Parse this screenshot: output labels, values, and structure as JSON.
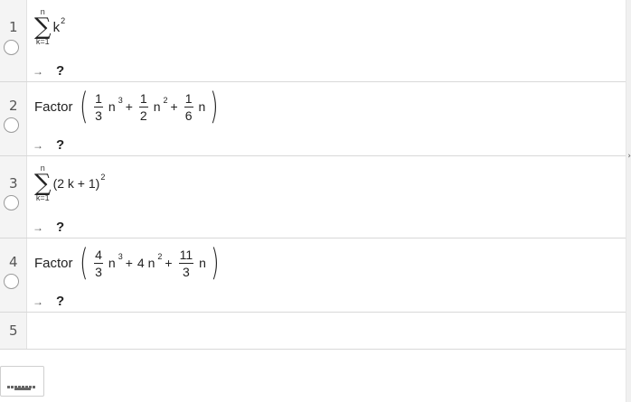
{
  "rows": [
    {
      "number": "1",
      "sum": {
        "upper": "n",
        "lower": "k=1",
        "sigma": "∑"
      },
      "body": "k",
      "exp": "2",
      "output": {
        "arrow": "→",
        "value": "?"
      }
    },
    {
      "number": "2",
      "command": "Factor",
      "terms": [
        {
          "num": "1",
          "den": "3",
          "var": "n",
          "exp": "3"
        },
        {
          "num": "1",
          "den": "2",
          "var": "n",
          "exp": "2"
        },
        {
          "num": "1",
          "den": "6",
          "var": "n",
          "exp": ""
        }
      ],
      "ops": [
        "+",
        "+"
      ],
      "output": {
        "arrow": "→",
        "value": "?"
      }
    },
    {
      "number": "3",
      "sum": {
        "upper": "n",
        "lower": "k=1",
        "sigma": "∑"
      },
      "body": "(2 k + 1)",
      "exp": "2",
      "output": {
        "arrow": "→",
        "value": "?"
      }
    },
    {
      "number": "4",
      "command": "Factor",
      "term1": {
        "num": "4",
        "den": "3",
        "var": "n",
        "exp": "3"
      },
      "term2": "4 n",
      "term2_exp": "2",
      "term3": {
        "num": "11",
        "den": "3",
        "var": "n"
      },
      "ops": [
        "+",
        "+"
      ],
      "output": {
        "arrow": "→",
        "value": "?"
      }
    },
    {
      "number": "5"
    }
  ],
  "colors": {
    "divider": "#d8d8d8",
    "gutter": "#f4f4f4",
    "text": "#222222"
  },
  "icons": {
    "keyboard": "keyboard-icon",
    "toggle": "circle-toggle-icon",
    "collapse": "chevron-right-icon"
  },
  "collapse_glyph": "›"
}
